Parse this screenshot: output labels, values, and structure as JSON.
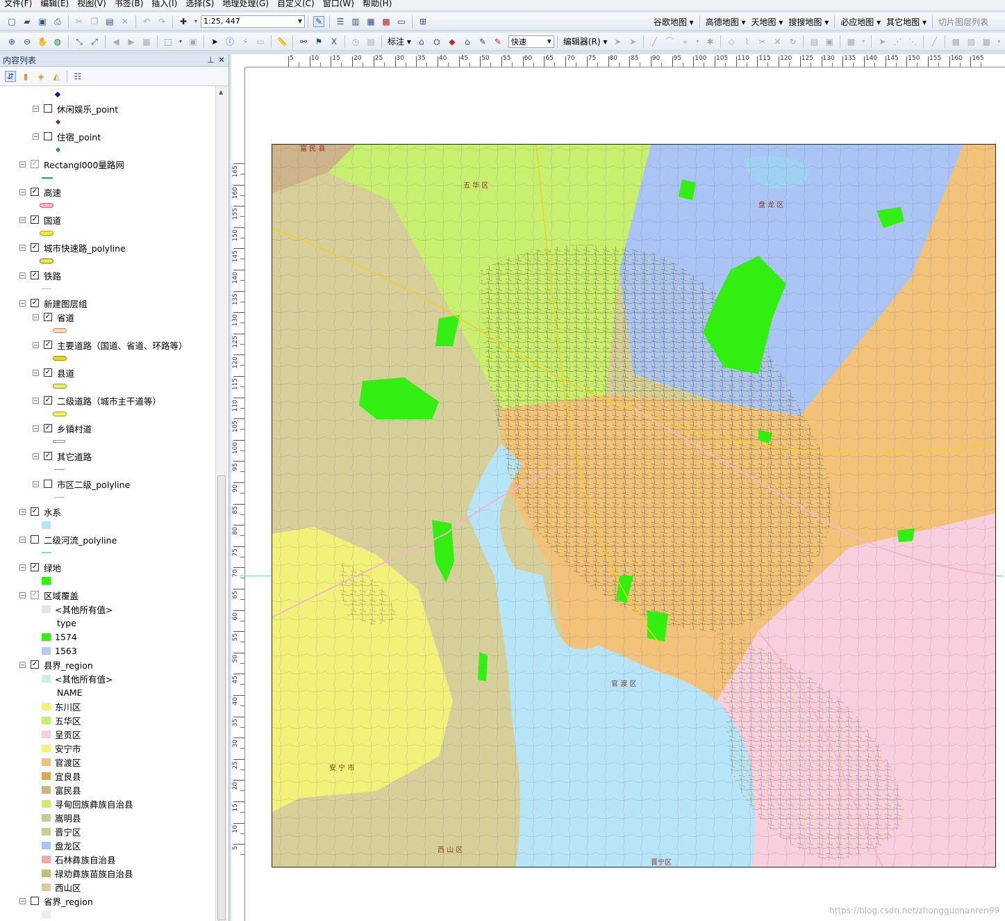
{
  "menu": [
    "文件(F)",
    "编辑(E)",
    "视图(V)",
    "书签(B)",
    "插入(I)",
    "选择(S)",
    "地理处理(G)",
    "自定义(C)",
    "窗口(W)",
    "帮助(H)"
  ],
  "toolbar": {
    "scale": "1:25, 447",
    "annotate_label": "标注",
    "render_mode": "快速",
    "editor_label": "编辑器(R)"
  },
  "web_maps": [
    "谷歌地图",
    "高德地图",
    "天地图",
    "搜搜地图",
    "必应地图",
    "其它地图"
  ],
  "tile_list_label": "切片图层列表",
  "toc": {
    "title": "内容列表",
    "layers": {
      "leisure_point": "休闲娱乐_point",
      "lodging_point": "住宿_point",
      "rect_roadnet": "Rectangl000量路网",
      "highway": "高速",
      "national_road": "国道",
      "expressway": "城市快速路_polyline",
      "railway": "铁路",
      "new_group": "新建图层组",
      "provincial_road": "省道",
      "main_roads": "主要道路（国道、省道、环路等）",
      "county_road": "县道",
      "secondary_roads": "二级道路（城市主干道等）",
      "village_road": "乡镇村道",
      "other_roads": "其它道路",
      "city_secondary": "市区二级_polyline",
      "water": "水系",
      "river2": "二级河流_polyline",
      "green": "绿地",
      "region_cover": "区域覆盖",
      "county_region": "县界_region",
      "province_region": "省界_region"
    },
    "other_values": "<其他所有值>",
    "type_field": "type",
    "type_values": [
      "1574",
      "1563"
    ],
    "name_field": "NAME",
    "counties": [
      "东川区",
      "五华区",
      "呈贡区",
      "安宁市",
      "官渡区",
      "宜良县",
      "富民县",
      "寻甸回族彝族自治县",
      "嵩明县",
      "晋宁区",
      "盘龙区",
      "石林彝族自治县",
      "禄劝彝族苗族自治县",
      "西山区"
    ],
    "county_colors": [
      "#f2f27a",
      "#c8ef6e",
      "#f9cfe0",
      "#f2f27a",
      "#f2c27a",
      "#e1a84a",
      "#cdb48b",
      "#c8ef6e",
      "#b8d494",
      "#c8cf9a",
      "#aac4f6",
      "#f0a8a8",
      "#c4c070",
      "#d6cf9a"
    ],
    "type_colors": [
      "#33ee11",
      "#b8c8f0"
    ]
  },
  "map": {
    "labels": {
      "fumin": "富 民 县",
      "wuhua": "五 华 区",
      "panlong": "盘 龙 区",
      "guandu": "官 渡 区",
      "anning": "安 宁 市",
      "xishan": "西 山 区",
      "jinning": "晋宁区"
    }
  },
  "rulers": {
    "h": [
      "5",
      "10",
      "15",
      "20",
      "25",
      "30",
      "35",
      "40",
      "45",
      "50",
      "55",
      "60",
      "65",
      "70",
      "75",
      "80",
      "85",
      "90",
      "95",
      "100",
      "105",
      "110",
      "115",
      "120",
      "125",
      "130",
      "135",
      "140",
      "145",
      "150",
      "155",
      "160",
      "165"
    ],
    "v": [
      "165",
      "160",
      "155",
      "150",
      "145",
      "140",
      "135",
      "130",
      "125",
      "120",
      "115",
      "110",
      "105",
      "100",
      "95",
      "90",
      "85",
      "80",
      "75",
      "70",
      "65",
      "60",
      "55",
      "50",
      "45",
      "40",
      "35",
      "30",
      "25",
      "20",
      "15",
      "10",
      "5"
    ]
  },
  "watermark": "https://blog.csdn.net/zhongguonanren99"
}
